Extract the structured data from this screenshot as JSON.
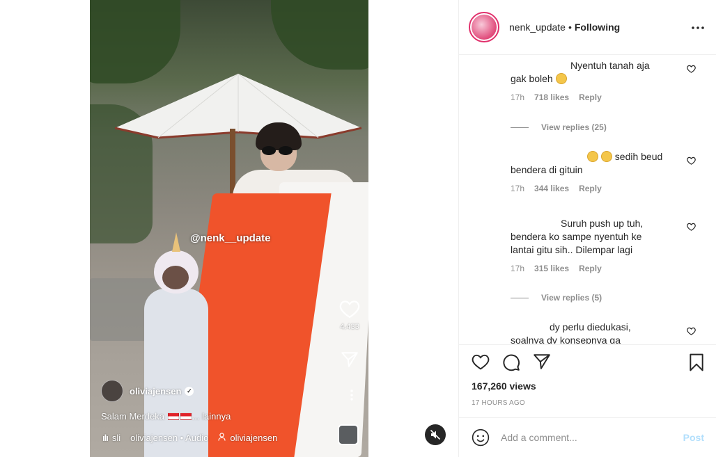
{
  "video": {
    "watermark": "@nenk__update",
    "like_count": "4.433",
    "author": "oliviajensen",
    "caption_start": "Salam Merdeka",
    "caption_end": "... lainnya",
    "audio_prefix": "sli",
    "audio_text": "oliviajensen • Audio",
    "audio_user": "oliviajensen"
  },
  "post": {
    "username": "nenk_update",
    "separator": "•",
    "follow_status": "Following"
  },
  "comments": [
    {
      "text_line1": "Nyentuh tanah aja",
      "text_line2": "gak boleh",
      "time": "17h",
      "likes": "718 likes",
      "reply": "Reply",
      "view_replies": "View replies (25)"
    },
    {
      "text_line1": "sedih beud",
      "text_line2": "bendera di gituin",
      "time": "17h",
      "likes": "344 likes",
      "reply": "Reply"
    },
    {
      "text_line1": "Suruh push up tuh,",
      "text_line2": "bendera ko sampe nyentuh ke",
      "text_line3": "lantai gitu sih.. Dilempar lagi",
      "time": "17h",
      "likes": "315 likes",
      "reply": "Reply",
      "view_replies": "View replies (5)"
    },
    {
      "text_line1": "dy perlu diedukasi,",
      "text_line2": "soalnya dy konsepnya ga"
    }
  ],
  "stats": {
    "views": "167,260 views",
    "posted_ago": "17 HOURS AGO"
  },
  "add_comment": {
    "placeholder": "Add a comment...",
    "post_label": "Post"
  },
  "colors": {
    "accent": "#0095f6",
    "post_disabled": "#b2dffc",
    "muted": "#8e8e8e",
    "text": "#262626",
    "avatar_ring": "#e1306c"
  },
  "icons": [
    "heart-icon",
    "share-icon",
    "more-icon",
    "mute-icon",
    "comment-icon",
    "bookmark-icon",
    "emoji-icon"
  ]
}
